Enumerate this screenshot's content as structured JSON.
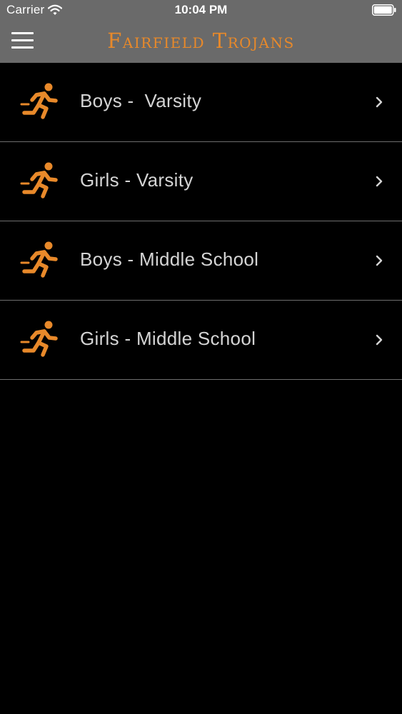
{
  "status_bar": {
    "carrier": "Carrier",
    "time": "10:04 PM",
    "icons": [
      "wifi-icon",
      "battery-icon"
    ]
  },
  "nav_bar": {
    "title": "Fairfield Trojans",
    "menu_icon": "hamburger-menu-icon"
  },
  "items": [
    {
      "label": "Boys -  Varsity",
      "icon": "runner-icon"
    },
    {
      "label": "Girls - Varsity",
      "icon": "runner-icon"
    },
    {
      "label": "Boys - Middle School",
      "icon": "runner-icon"
    },
    {
      "label": "Girls - Middle School",
      "icon": "runner-icon"
    }
  ],
  "colors": {
    "accent": "#e8892a",
    "header_background": "#6a6a6a",
    "background": "#000000",
    "list_text": "#d4d4d4"
  }
}
